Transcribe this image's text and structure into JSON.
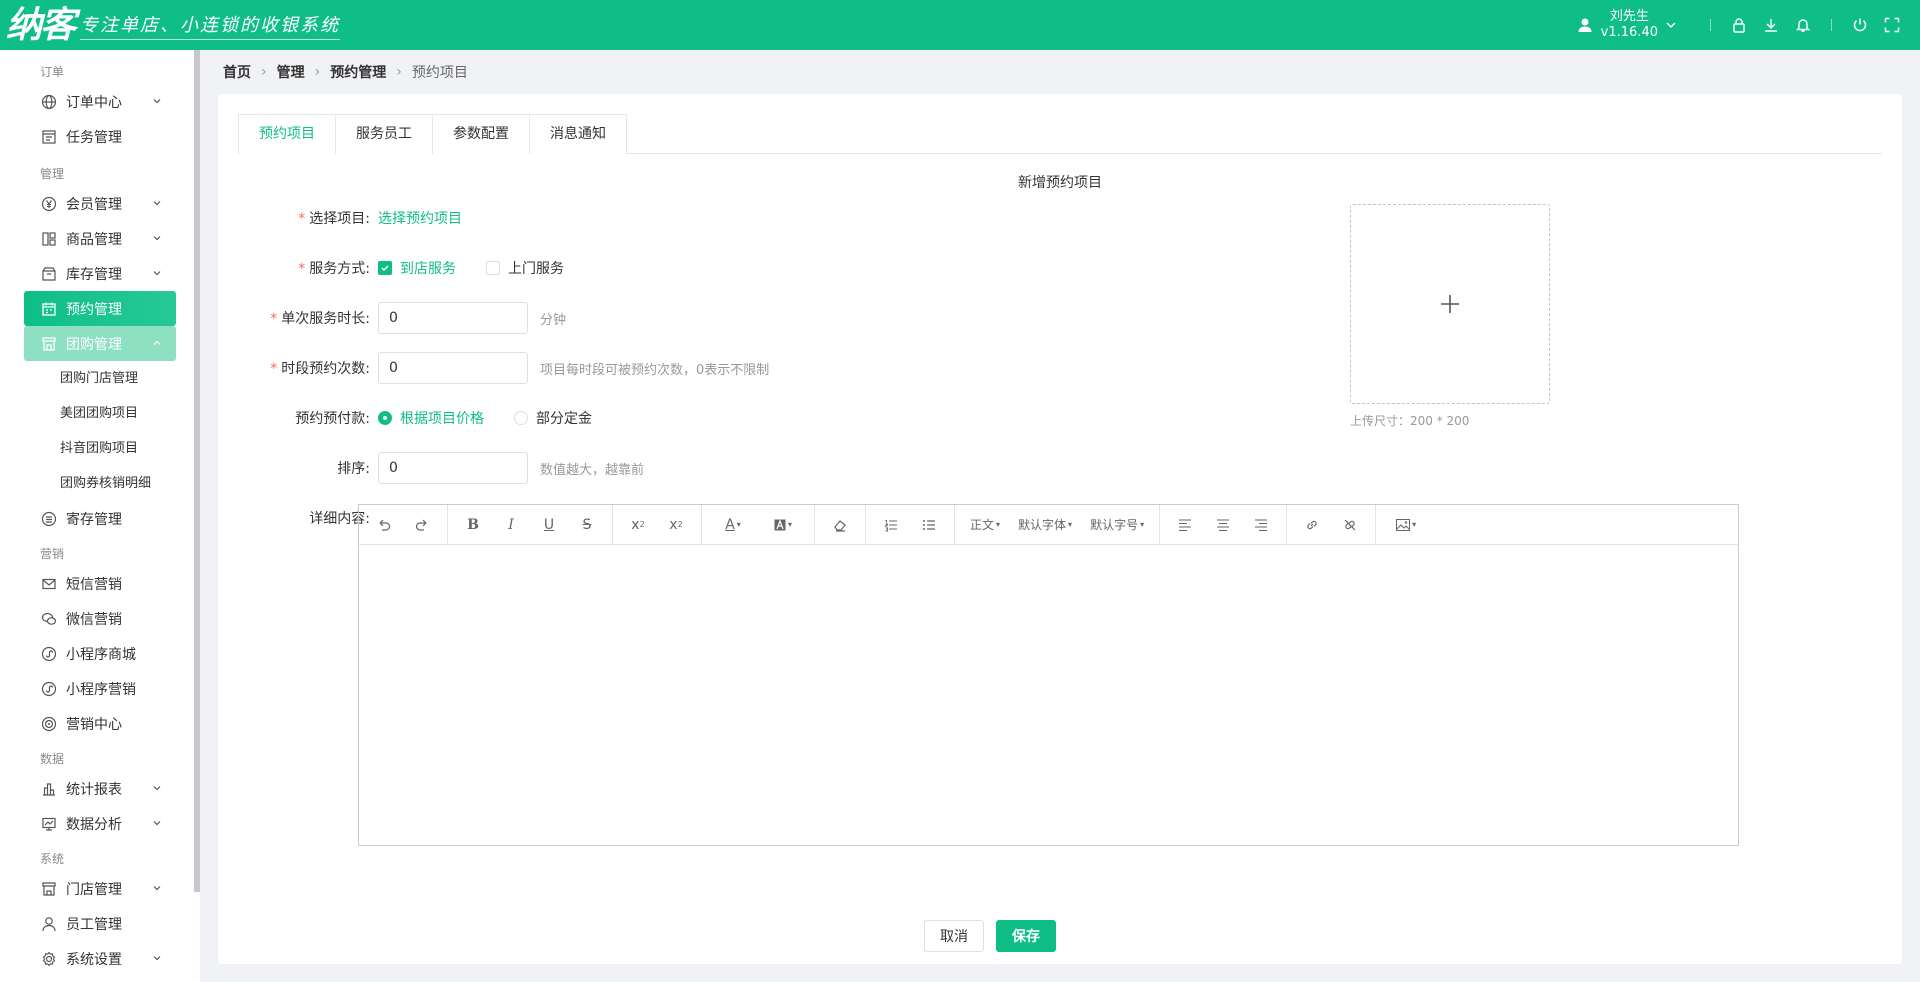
{
  "header": {
    "logo_text": "纳客",
    "slogan": "专注单店、小连锁的收银系统",
    "user_name": "刘先生",
    "version": "v1.16.40"
  },
  "sidebar": {
    "groups": [
      {
        "title": "订单",
        "items": [
          {
            "label": "订单中心",
            "icon": "globe-icon",
            "chevron": true
          },
          {
            "label": "任务管理",
            "icon": "task-icon",
            "chevron": false
          }
        ]
      },
      {
        "title": "管理",
        "items": [
          {
            "label": "会员管理",
            "icon": "yen-circle-icon",
            "chevron": true
          },
          {
            "label": "商品管理",
            "icon": "grid-icon",
            "chevron": true
          },
          {
            "label": "库存管理",
            "icon": "box-icon",
            "chevron": true
          },
          {
            "label": "预约管理",
            "icon": "calendar-icon",
            "chevron": false,
            "active": true
          },
          {
            "label": "团购管理",
            "icon": "shop-icon",
            "chevron": true,
            "open": true,
            "children": [
              "团购门店管理",
              "美团团购项目",
              "抖音团购项目",
              "团购券核销明细"
            ]
          },
          {
            "label": "寄存管理",
            "icon": "storage-icon",
            "chevron": false
          }
        ]
      },
      {
        "title": "营销",
        "items": [
          {
            "label": "短信营销",
            "icon": "mail-icon",
            "chevron": false
          },
          {
            "label": "微信营销",
            "icon": "wechat-icon",
            "chevron": false
          },
          {
            "label": "小程序商城",
            "icon": "miniapp-icon",
            "chevron": false
          },
          {
            "label": "小程序营销",
            "icon": "miniapp-icon",
            "chevron": false
          },
          {
            "label": "营销中心",
            "icon": "target-icon",
            "chevron": false
          }
        ]
      },
      {
        "title": "数据",
        "items": [
          {
            "label": "统计报表",
            "icon": "bar-chart-icon",
            "chevron": true
          },
          {
            "label": "数据分析",
            "icon": "monitor-chart-icon",
            "chevron": true
          }
        ]
      },
      {
        "title": "系统",
        "items": [
          {
            "label": "门店管理",
            "icon": "store-icon",
            "chevron": true
          },
          {
            "label": "员工管理",
            "icon": "user-icon",
            "chevron": false
          },
          {
            "label": "系统设置",
            "icon": "gear-icon",
            "chevron": true
          }
        ]
      }
    ]
  },
  "breadcrumb": [
    "首页",
    "管理",
    "预约管理",
    "预约项目"
  ],
  "tabs": [
    "预约项目",
    "服务员工",
    "参数配置",
    "消息通知"
  ],
  "active_tab": 0,
  "form": {
    "title": "新增预约项目",
    "select_item": {
      "label": "选择项目:",
      "link": "选择预约项目"
    },
    "service_mode": {
      "label": "服务方式:",
      "options": [
        {
          "label": "到店服务",
          "checked": true
        },
        {
          "label": "上门服务",
          "checked": false
        }
      ]
    },
    "duration": {
      "label": "单次服务时长:",
      "value": "0",
      "unit": "分钟"
    },
    "slot_count": {
      "label": "时段预约次数:",
      "value": "0",
      "hint": "项目每时段可被预约次数，0表示不限制"
    },
    "prepay": {
      "label": "预约预付款:",
      "options": [
        {
          "label": "根据项目价格",
          "checked": true
        },
        {
          "label": "部分定金",
          "checked": false
        }
      ]
    },
    "sort": {
      "label": "排序:",
      "value": "0",
      "hint": "数值越大，越靠前"
    },
    "detail": {
      "label": "详细内容:"
    },
    "upload_hint": "上传尺寸：200 * 200"
  },
  "editor": {
    "format": "正文",
    "font": "默认字体",
    "size": "默认字号"
  },
  "buttons": {
    "cancel": "取消",
    "save": "保存"
  },
  "colors": {
    "primary": "#0fbe87",
    "required": "#f56c6c"
  }
}
